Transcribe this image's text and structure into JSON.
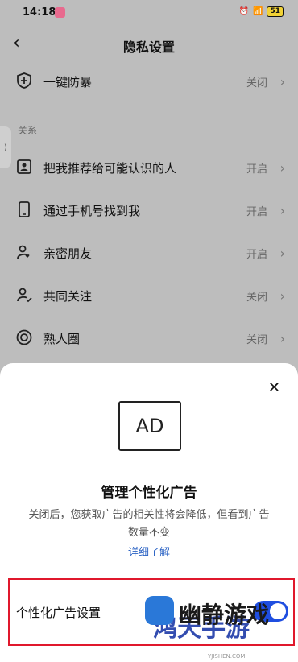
{
  "status": {
    "time": "14:18",
    "battery": "51"
  },
  "header": {
    "title": "隐私设置"
  },
  "rows": [
    {
      "label": "一键防暴",
      "value": "关闭"
    },
    {
      "label": "把我推荐给可能认识的人",
      "value": "开启"
    },
    {
      "label": "通过手机号找到我",
      "value": "开启"
    },
    {
      "label": "亲密朋友",
      "value": "开启"
    },
    {
      "label": "共同关注",
      "value": "关闭"
    },
    {
      "label": "熟人圈",
      "value": "关闭"
    }
  ],
  "section": {
    "relations": "关系"
  },
  "sheet": {
    "ad_badge": "AD",
    "title": "管理个性化广告",
    "description": "关闭后，您获取广告的相关性将会降低，但看到广告数量不变",
    "learn_more": "详细了解",
    "setting_label": "个性化广告设置"
  },
  "watermark": {
    "text": "幽静游戏",
    "sub": "YJISHEN.COM",
    "brand": "鸿天手游"
  },
  "colors": {
    "toggle_on": "#1f4ee0",
    "highlight": "#e0182c",
    "link": "#2b63c4"
  }
}
